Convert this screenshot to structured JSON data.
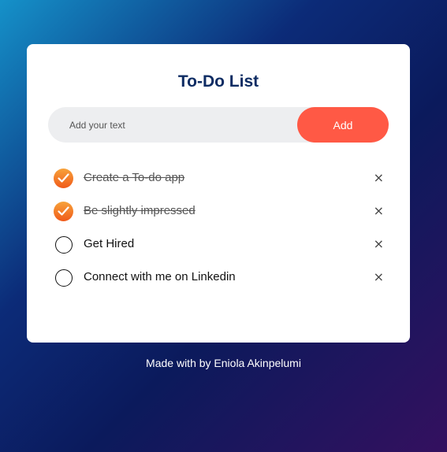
{
  "app": {
    "title": "To-Do List"
  },
  "input": {
    "placeholder": "Add your text",
    "value": ""
  },
  "add_button": {
    "label": "Add",
    "color": "#ff5945"
  },
  "tasks": [
    {
      "text": "Create a To-do app",
      "done": true,
      "delete_icon": "×"
    },
    {
      "text": "Be slightly impressed",
      "done": true,
      "delete_icon": "×"
    },
    {
      "text": "Get Hired",
      "done": false,
      "delete_icon": "×"
    },
    {
      "text": "Connect with me on Linkedin",
      "done": false,
      "delete_icon": "×"
    }
  ],
  "footer": {
    "text": "Made with by Eniola Akinpelumi"
  },
  "colors": {
    "title": "#0e2c63",
    "check_done_top": "#f7a23a",
    "check_done_bottom": "#f05a1a"
  }
}
